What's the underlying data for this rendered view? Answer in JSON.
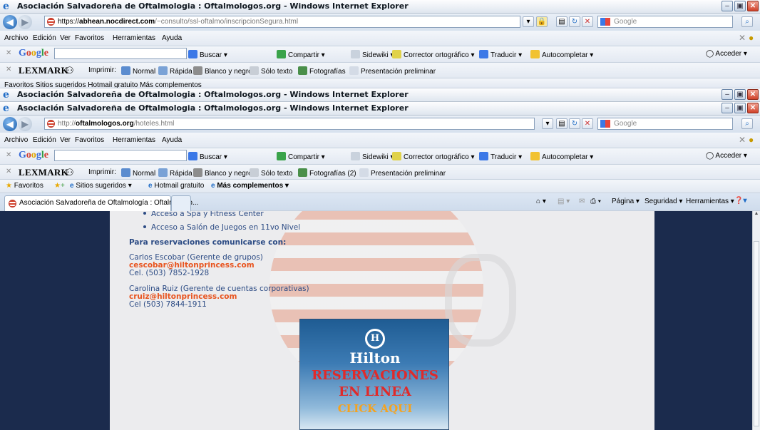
{
  "window_back": {
    "title": "Asociación Salvadoreña de Oftalmologia : Oftalmologos.org - Windows Internet Explorer",
    "url_prefix": "https://",
    "url_host": "abhean.nocdirect.com",
    "url_path": "/~consulto/ssl-oftalmo/inscripcionSegura.html"
  },
  "window_mid": {
    "title": "Asociación Salvadoreña de Oftalmologia : Oftalmologos.org - Windows Internet Explorer"
  },
  "window_front": {
    "title": "Asociación Salvadoreña de Oftalmologia : Oftalmologos.org - Windows Internet Explorer",
    "url_prefix": "http://",
    "url_host": "oftalmologos.org",
    "url_path": "/hoteles.html",
    "tab_label": "Asociación Salvadoreña de Oftalmología : Oftalmologo..."
  },
  "search_placeholder": "Google",
  "menu": [
    "Archivo",
    "Edición",
    "Ver",
    "Favoritos",
    "Herramientas",
    "Ayuda"
  ],
  "google_toolbar": {
    "buscar": "Buscar",
    "compartir": "Compartir",
    "sidewiki": "Sidewiki",
    "corrector": "Corrector ortográfico",
    "traducir": "Traducir",
    "autocompletar": "Autocompletar",
    "acceder": "Acceder"
  },
  "lexmark_toolbar": {
    "brand": "LEXMARK",
    "imprimir": "Imprimir:",
    "normal": "Normal",
    "rapida": "Rápida",
    "blanco": "Blanco y negro",
    "solo_texto": "Sólo texto",
    "fotografias_back": "Fotografías",
    "fotografias_front": "Fotografías (2)",
    "presentacion": "Presentación preliminar"
  },
  "favorites_bar": {
    "favoritos": "Favoritos",
    "sitios": "Sitios sugeridos",
    "hotmail": "Hotmail gratuito",
    "complementos": "Más complementos",
    "back_partial": "Favoritos    Sitios sugeridos    Hotmail gratuito    Más complementos"
  },
  "command_bar": {
    "pagina": "Página",
    "seguridad": "Seguridad",
    "herramientas": "Herramientas"
  },
  "content": {
    "bullets": [
      "Acceso a Spa y Fitness Center",
      "Acceso a Salón de Juegos en 11vo Nivel"
    ],
    "reservas_heading": "Para reservaciones comunicarse con:",
    "contact1_name": "Carlos Escobar (Gerente de grupos)",
    "contact1_email": "cescobar@hiltonprincess.com",
    "contact1_phone": "Cel. (503) 7852-1928",
    "contact2_name": "Carolina Ruiz (Gerente de cuentas corporativas)",
    "contact2_email": "cruiz@hiltonprincess.com",
    "contact2_phone": "Cel (503) 7844-1911"
  },
  "banner": {
    "logo": "H",
    "brand": "Hilton",
    "line1": "RESERVACIONES",
    "line2": "EN LINEA",
    "cta": "CLICK AQUI"
  },
  "colors": {
    "content_bg": "#1b2b4d",
    "link_blue": "#2c4b84",
    "email_orange": "#e8541f",
    "banner_red": "#e02a2a",
    "banner_orange": "#f6a21c"
  }
}
